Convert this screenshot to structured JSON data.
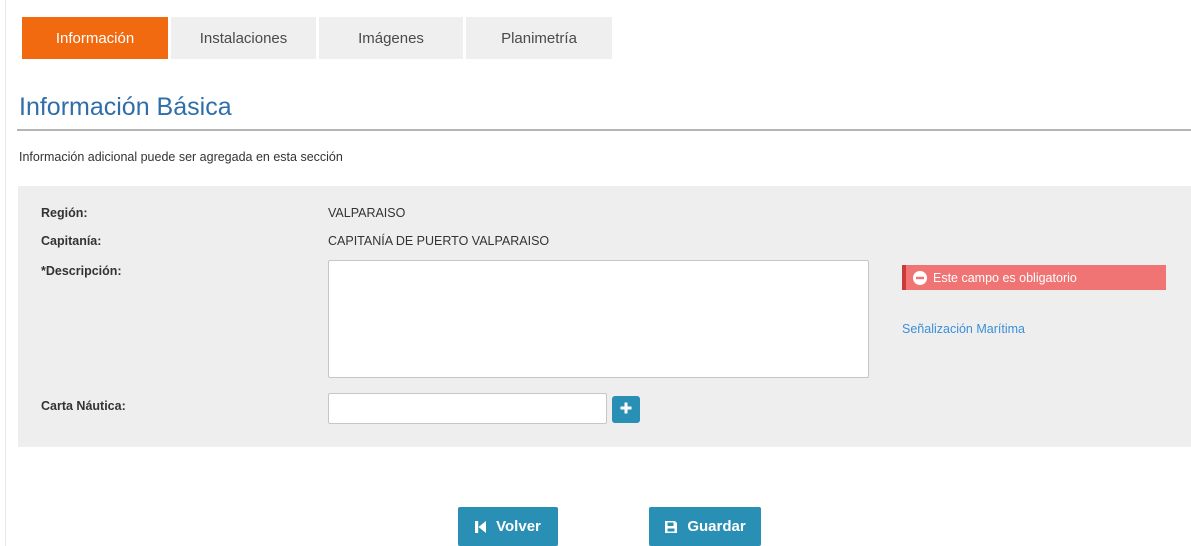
{
  "colors": {
    "accent": "#f26a10",
    "primary_button": "#2a8fb4",
    "title_blue": "#2f6ea8",
    "error_bg": "#f07474",
    "link": "#3c8fd8"
  },
  "tabs": [
    {
      "label": "Información",
      "active": true
    },
    {
      "label": "Instalaciones",
      "active": false
    },
    {
      "label": "Imágenes",
      "active": false
    },
    {
      "label": "Planimetría",
      "active": false
    }
  ],
  "page": {
    "title": "Información Básica",
    "subtitle": "Información adicional puede ser agregada en esta sección"
  },
  "form": {
    "region": {
      "label": "Región:",
      "value": "VALPARAISO"
    },
    "capitania": {
      "label": "Capitanía:",
      "value": "CAPITANÍA DE PUERTO VALPARAISO"
    },
    "descripcion": {
      "label": "*Descripción:",
      "value": "",
      "error": "Este campo es obligatorio",
      "error_icon": "minus-circle-icon"
    },
    "carta_nautica": {
      "label": "Carta Náutica:",
      "value": "",
      "add_icon": "plus-icon"
    },
    "side_link": "Señalización Marítima"
  },
  "buttons": {
    "back": {
      "label": "Volver",
      "icon": "step-backward-icon"
    },
    "save": {
      "label": "Guardar",
      "icon": "floppy-disk-icon"
    }
  }
}
